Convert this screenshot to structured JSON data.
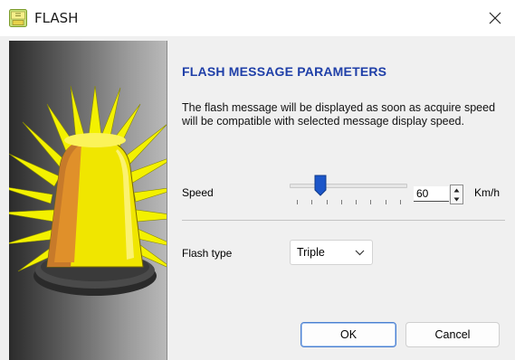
{
  "window": {
    "title": "FLASH",
    "app_icon": "flash-app-icon",
    "close_icon": "close-icon",
    "close_glyph": "✕"
  },
  "panel": {
    "illustration": "flashing-beacon-illustration"
  },
  "heading": "FLASH MESSAGE PARAMETERS",
  "description": "The flash message will be displayed as soon as acquire speed will be compatible with selected message display speed.",
  "speed": {
    "label": "Speed",
    "value": "60",
    "unit": "Km/h",
    "slider_position": 0.22,
    "tick_count": 8
  },
  "flash_type": {
    "label": "Flash type",
    "selected": "Triple"
  },
  "buttons": {
    "ok": "OK",
    "cancel": "Cancel"
  },
  "colors": {
    "heading": "#1f3fa8",
    "slider_thumb": "#1c56c9",
    "beacon_yellow": "#f6f100",
    "ok_border": "#4a7fd0"
  }
}
